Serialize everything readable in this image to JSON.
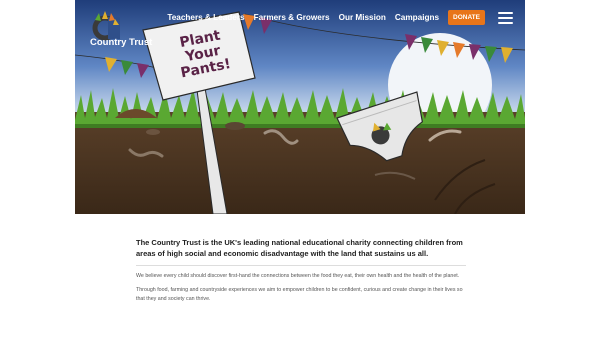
{
  "brand": {
    "name": "Country Trust"
  },
  "nav": {
    "items": [
      {
        "label": "Teachers & Leaders"
      },
      {
        "label": "Farmers & Growers"
      },
      {
        "label": "Our Mission"
      },
      {
        "label": "Campaigns"
      }
    ],
    "donate_label": "DONATE"
  },
  "hero": {
    "sign_text": "Plant Your Pants!"
  },
  "content": {
    "lead": "The Country Trust is the UK's leading national educational charity connecting children from areas of high social and economic disadvantage with the land that sustains us all.",
    "paragraphs": [
      "We believe every child should discover first-hand the connections between the food they eat, their own health and the health of the planet.",
      "Through food, farming and countryside experiences we aim to empower children to be confident, curious and create change in their lives so that they and society can thrive."
    ]
  },
  "colors": {
    "sky": "#2f4f8a",
    "soil": "#4a3522",
    "grass": "#5aa832",
    "donate": "#e8751a",
    "sign_text": "#5a2347"
  },
  "icons": {
    "menu": "hamburger-menu-icon",
    "logo": "wheat-c-logo-icon"
  }
}
